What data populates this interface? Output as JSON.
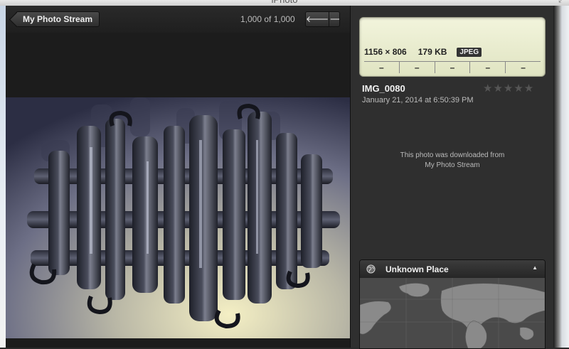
{
  "window": {
    "title": "iPhoto",
    "fullscreen_icon": "fullscreen-icon"
  },
  "toolbar": {
    "back_label": "My Photo Stream",
    "counter": "1,000 of 1,000",
    "prev_icon": "arrow-left-icon",
    "next_icon": "arrow-right-icon"
  },
  "info": {
    "dimensions": "1156 × 806",
    "file_size": "179 KB",
    "format": "JPEG",
    "exif": [
      "–",
      "–",
      "–",
      "–",
      "–"
    ],
    "title": "IMG_0080",
    "date": "January 21, 2014 at 6:50:39 PM",
    "rating": "★★★★★",
    "rating_value": 0,
    "note_line1": "This photo was downloaded from",
    "note_line2": "My Photo Stream"
  },
  "places": {
    "title": "Unknown Place",
    "icon": "globe-icon",
    "collapse_glyph": "▲"
  },
  "colors": {
    "panel": "#2f2f2f",
    "viewer": "#1c1c1c",
    "lcd": "#eef1d5"
  }
}
